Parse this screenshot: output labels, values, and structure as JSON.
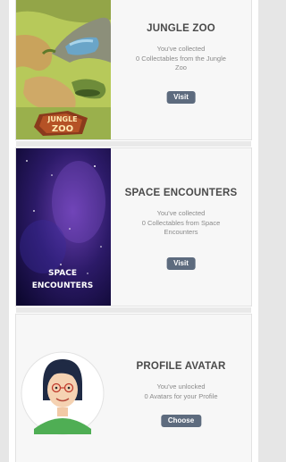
{
  "cards": [
    {
      "title": "JUNGLE ZOO",
      "desc_line1": "You've collected",
      "desc_line2": "0 Collectables from the Jungle",
      "desc_line3": "Zoo",
      "button_label": "Visit",
      "thumb_label_line1": "JUNGLE",
      "thumb_label_line2": "ZOO"
    },
    {
      "title": "SPACE ENCOUNTERS",
      "desc_line1": "You've collected",
      "desc_line2": "0 Collectables from Space",
      "desc_line3": "Encounters",
      "button_label": "Visit",
      "thumb_label_line1": "SPACE",
      "thumb_label_line2": "ENCOUNTERS"
    },
    {
      "title": "PROFILE AVATAR",
      "desc_line1": "You've unlocked",
      "desc_line2": "0 Avatars for your Profile",
      "button_label": "Choose"
    }
  ],
  "colors": {
    "button": "#5d6b7e",
    "title": "#4a4a4a",
    "text": "#8a8a8a"
  }
}
